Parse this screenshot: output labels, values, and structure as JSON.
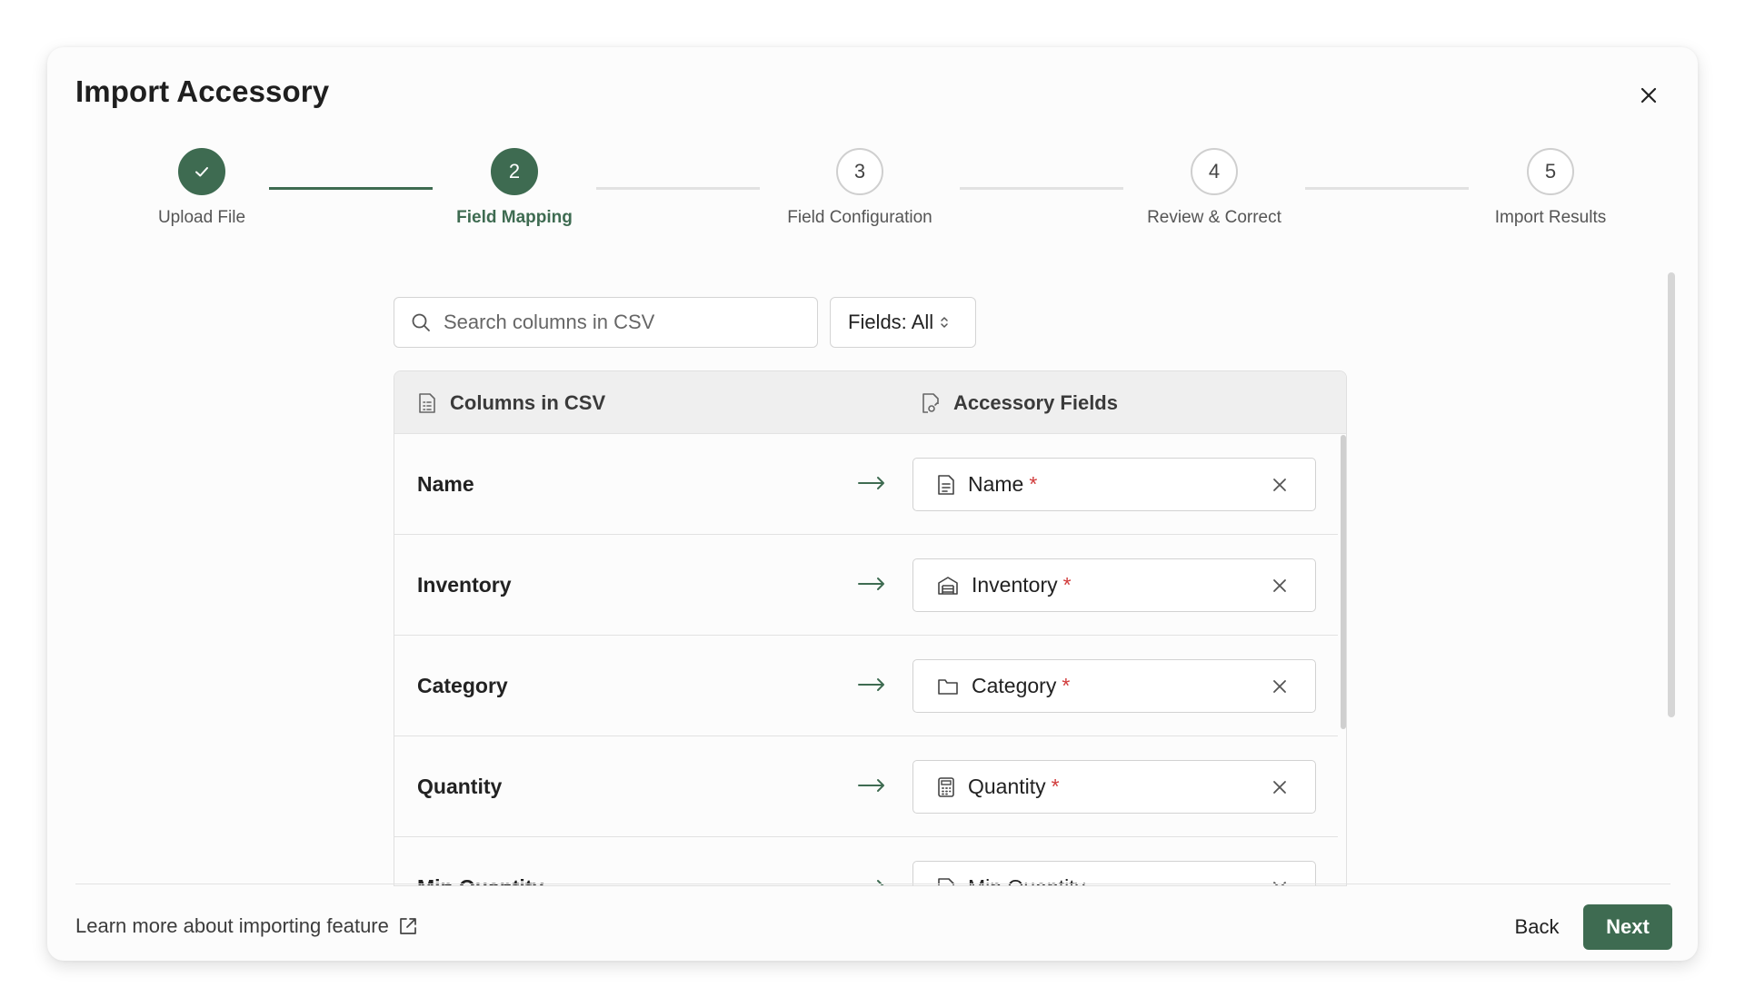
{
  "dialog": {
    "title": "Import Accessory"
  },
  "stepper": {
    "steps": [
      {
        "number": "1",
        "label": "Upload File",
        "state": "completed"
      },
      {
        "number": "2",
        "label": "Field Mapping",
        "state": "active"
      },
      {
        "number": "3",
        "label": "Field Configuration",
        "state": "pending"
      },
      {
        "number": "4",
        "label": "Review & Correct",
        "state": "pending"
      },
      {
        "number": "5",
        "label": "Import Results",
        "state": "pending"
      }
    ]
  },
  "toolbar": {
    "search_placeholder": "Search columns in CSV",
    "search_value": "",
    "filter_label": "Fields: All"
  },
  "table": {
    "csv_header": "Columns in CSV",
    "fields_header": "Accessory Fields",
    "rows": [
      {
        "csv_column": "Name",
        "field": "Name",
        "field_icon": "document-icon",
        "required_mark": "*"
      },
      {
        "csv_column": "Inventory",
        "field": "Inventory",
        "field_icon": "warehouse-icon",
        "required_mark": "*"
      },
      {
        "csv_column": "Category",
        "field": "Category",
        "field_icon": "folder-icon",
        "required_mark": "*"
      },
      {
        "csv_column": "Quantity",
        "field": "Quantity",
        "field_icon": "calculator-icon",
        "required_mark": "*"
      },
      {
        "csv_column": "Min Quantity",
        "field": "Min Quantity",
        "field_icon": "field-icon",
        "required_mark": ""
      }
    ]
  },
  "footer": {
    "learn_more": "Learn more about importing feature",
    "back_label": "Back",
    "next_label": "Next"
  },
  "colors": {
    "accent": "#3e6b51",
    "required": "#d13b3b"
  }
}
